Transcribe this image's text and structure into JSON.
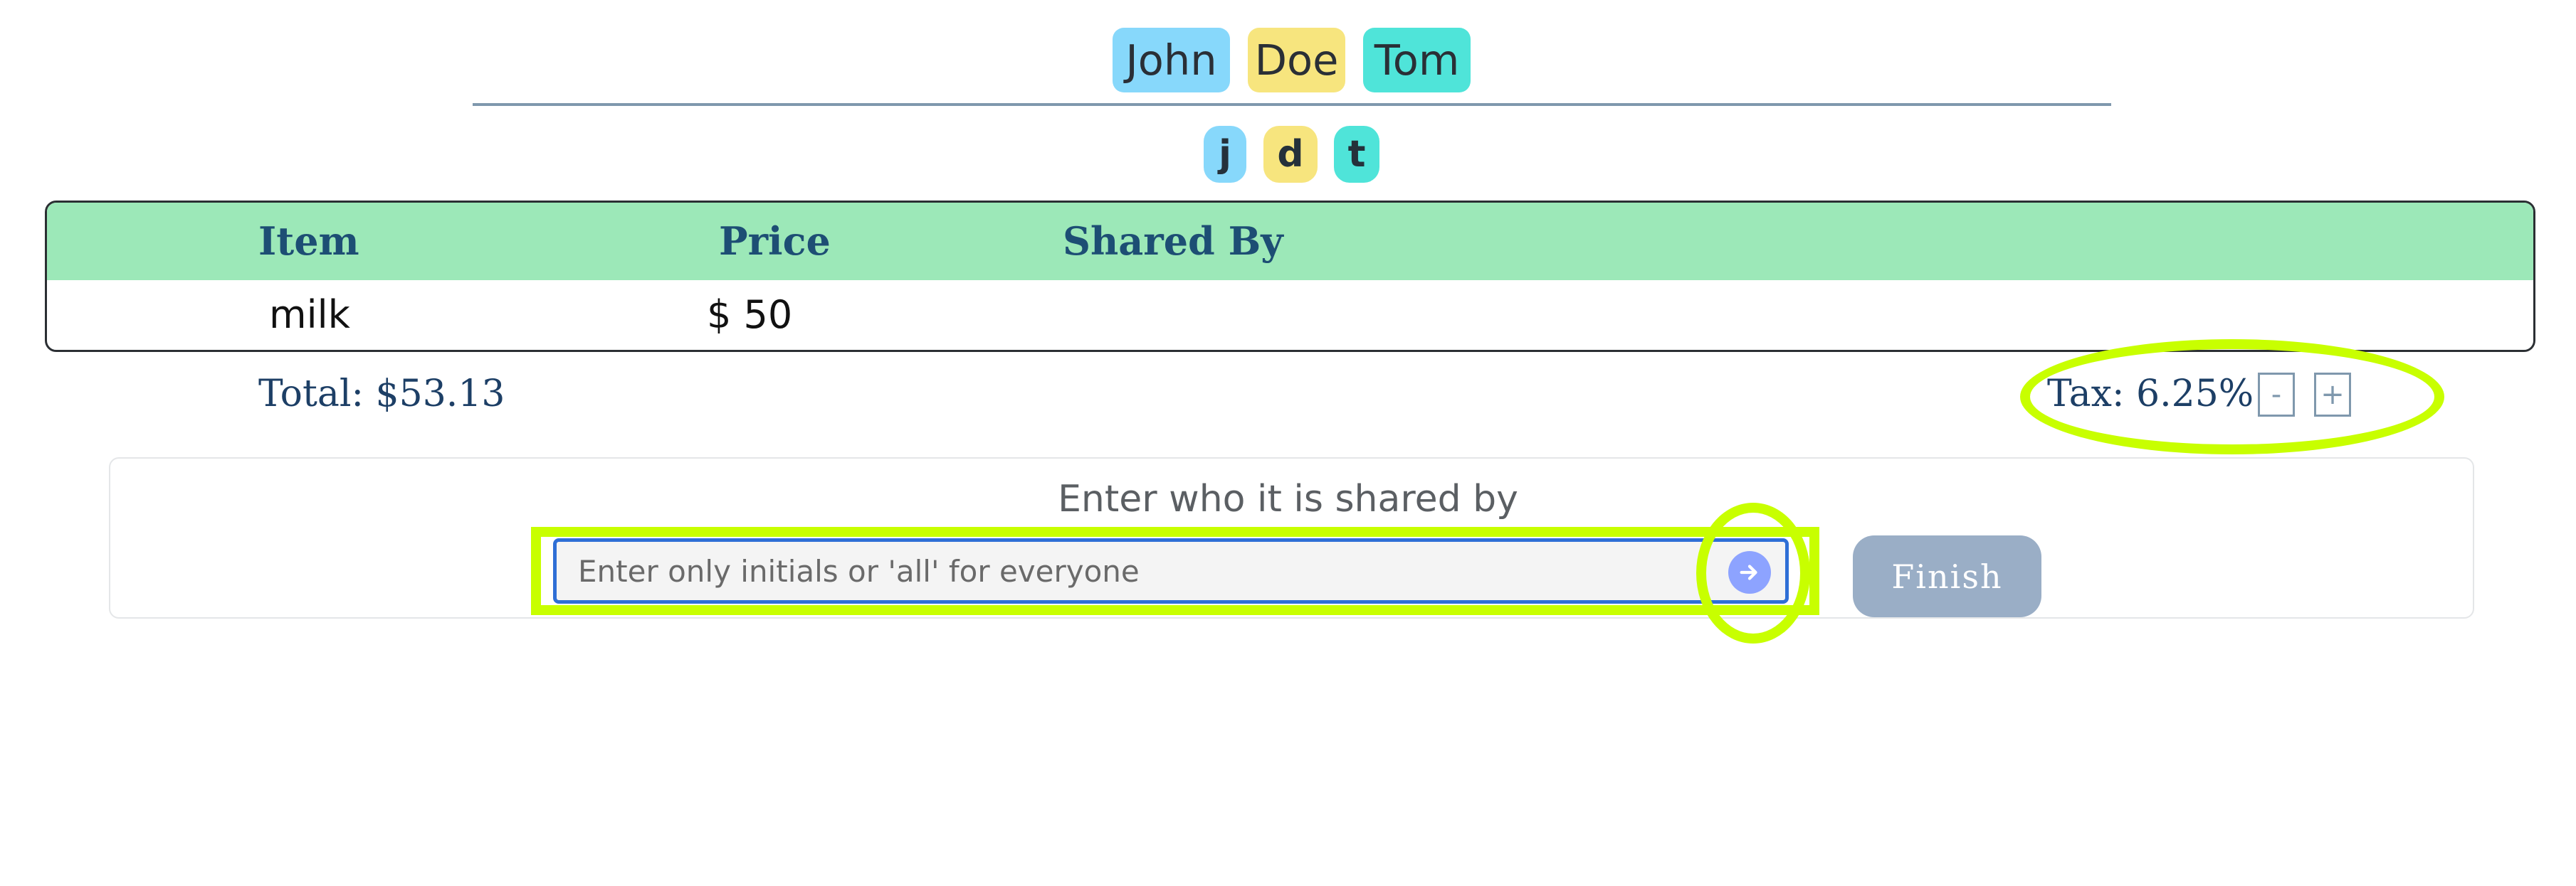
{
  "names": [
    {
      "label": "John",
      "color": "#87d8fb"
    },
    {
      "label": "Doe",
      "color": "#f7e57e"
    },
    {
      "label": "Tom",
      "color": "#4fe4d9"
    }
  ],
  "initials": [
    {
      "label": "j",
      "color": "#87d8fb"
    },
    {
      "label": "d",
      "color": "#f7e57e"
    },
    {
      "label": "t",
      "color": "#4fe4d9"
    }
  ],
  "table": {
    "headers": [
      "Item",
      "Price",
      "Shared By"
    ],
    "rows": [
      {
        "item": "milk",
        "price": "$ 50",
        "shared_by": ""
      }
    ],
    "header_color": "#9ce8b8"
  },
  "summary": {
    "total": "Total: $53.13",
    "tax": "Tax: 6.25%",
    "decrement_label": "-",
    "increment_label": "+"
  },
  "shared_form": {
    "title": "Enter who it is shared by",
    "placeholder": "Enter only initials or 'all' for everyone",
    "submit_icon": "arrow-right-icon",
    "finish_label": "Finish"
  },
  "highlight_color": "#c8ff00"
}
